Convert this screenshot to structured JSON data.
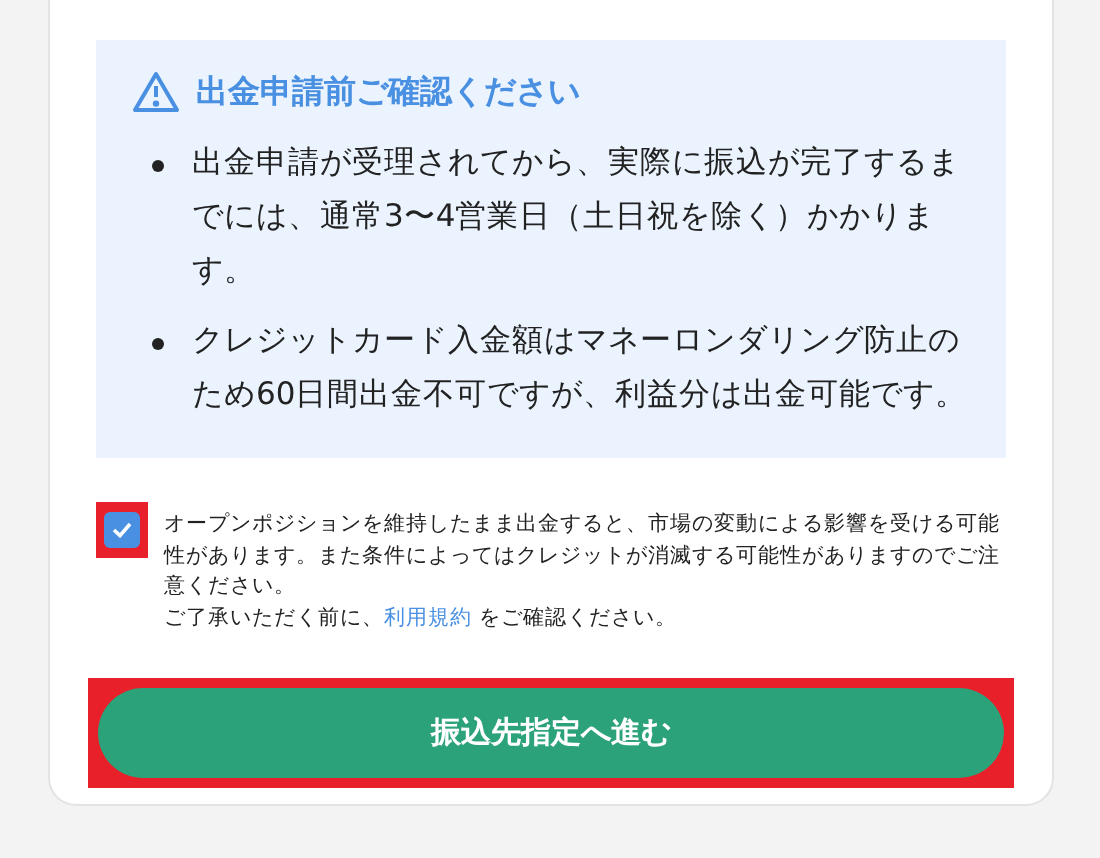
{
  "notice": {
    "title": "出金申請前ご確認ください",
    "items": [
      "出金申請が受理されてから、実際に振込が完了するまでには、通常3〜4営業日（土日祝を除く）かかります。",
      "クレジットカード入金額はマネーロンダリング防止のため60日間出金不可ですが、利益分は出金可能です。"
    ]
  },
  "agreement": {
    "checked": true,
    "highlighted": true,
    "text": "オープンポジションを維持したまま出金すると、市場の変動による影響を受ける可能性があります。また条件によってはクレジットが消滅する可能性がありますのでご注意ください。",
    "terms_before": "ご了承いただく前に、",
    "terms_link": "利用規約",
    "terms_after": " をご確認ください。"
  },
  "submit": {
    "label": "振込先指定へ進む",
    "highlighted": true
  }
}
